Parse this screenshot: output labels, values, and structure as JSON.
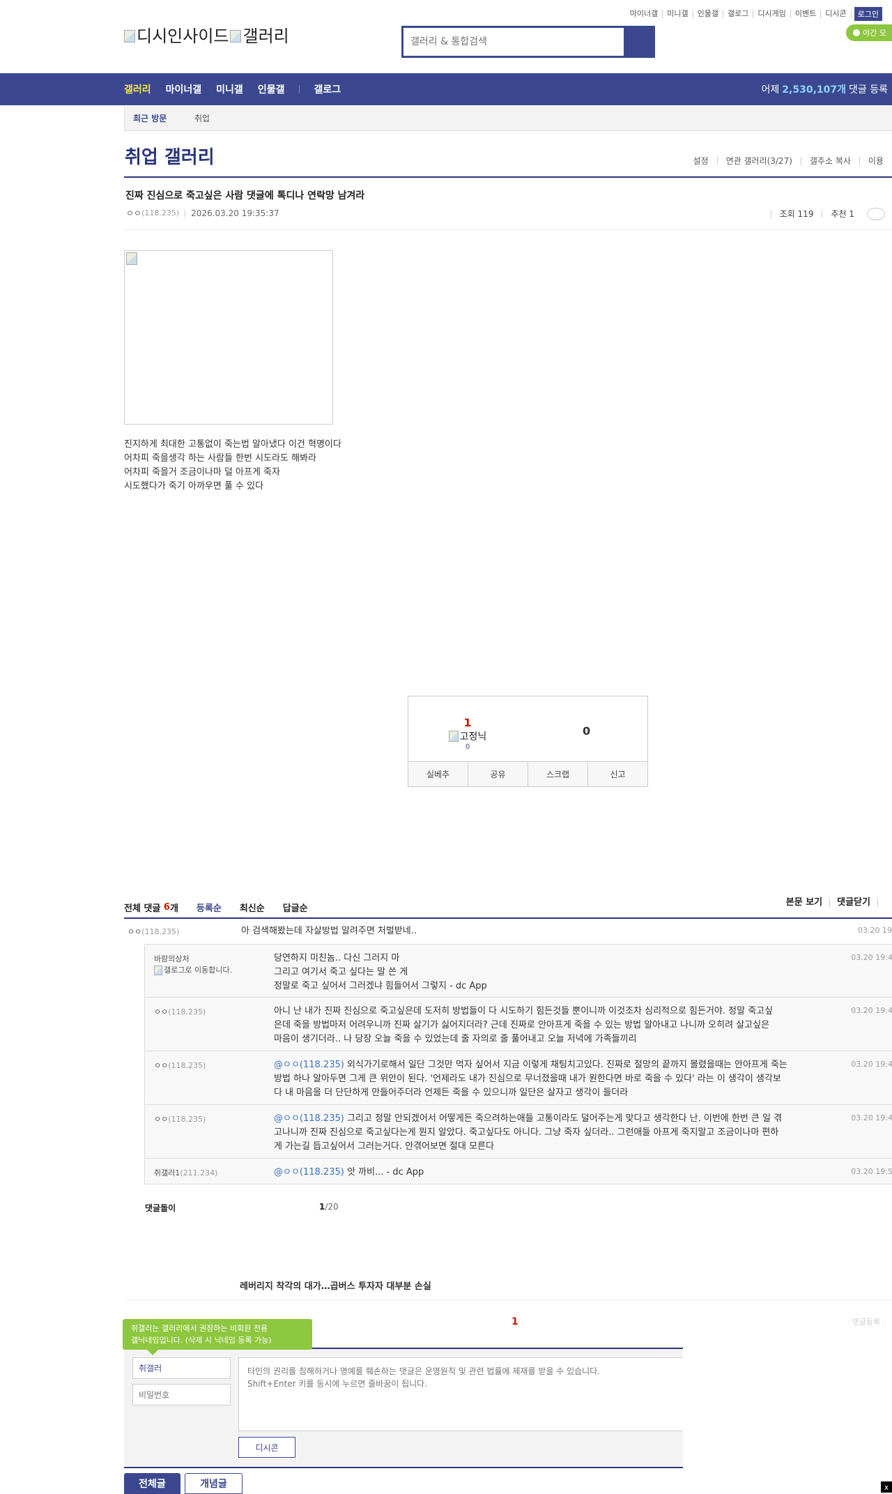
{
  "header": {
    "logo_alt": "디시인사이드",
    "logo_sub_alt": "갤러리",
    "search_placeholder": "갤러리 & 통합검색",
    "top_links": [
      "마이너갤",
      "미니갤",
      "인물갤",
      "갤로그",
      "디시게임",
      "이벤트",
      "디시콘"
    ],
    "login_label": "로그인",
    "night_label": "야간 모"
  },
  "nav": {
    "items": [
      "갤러리",
      "마이너갤",
      "미니갤",
      "인물갤"
    ],
    "gallog": "갤로그",
    "yesterday_prefix": "어제",
    "yesterday_count": "2,530,107개",
    "yesterday_suffix": "댓글 등록"
  },
  "recent": {
    "label": "최근 방문",
    "item": "취업"
  },
  "gallery": {
    "title": "취업 갤러리",
    "links": [
      "설정",
      "연관 갤러리(3/27)",
      "갤주소 복사",
      "이용"
    ]
  },
  "post": {
    "title": "진짜 진심으로 죽고싶은 사람 댓글에 톡디나 연락망 남겨라",
    "author": "ㅇㅇ",
    "ip": "(118.235)",
    "datetime": "2026.03.20 19:35:37",
    "views": "조회 119",
    "recommend": "추천 1",
    "content_lines": [
      "진지하게 최대한 고통없이 죽는법 알아냈다 이건 혁명이다",
      "어차피 죽을생각 하는 사람들 한번 시도라도 해봐라",
      "어차피 죽을거 조금이나마 덜 아프게 죽자",
      "시도했다가 죽기 아까우면 풀 수 있다"
    ]
  },
  "recommend_box": {
    "up_count": "1",
    "fixed_nick_alt": "고정닉",
    "fixed_count": "0",
    "down_count": "0",
    "buttons": [
      "실베추",
      "공유",
      "스크랩",
      "신고"
    ]
  },
  "comments": {
    "label": "전체 댓글",
    "count": "6",
    "unit": "개",
    "tabs": [
      "등록순",
      "최신순",
      "답글순"
    ],
    "right_links": [
      "본문 보기",
      "댓글닫기"
    ],
    "main": {
      "nick": "ㅇㅇ",
      "ip": "(118.235)",
      "text": "아 검색해봤는데 자살방법 알려주면 처벌받네..",
      "date": "03.20 19"
    },
    "replies": [
      {
        "nick": "바람의상처",
        "ip": "",
        "gallog": "갤로그로 이동합니다.",
        "at": "",
        "lines": [
          "당연하지 미친놈.. 다신 그러지 마",
          "그리고 여기서 죽고 싶다는 말 쓴 게",
          "정말로 죽고 싶어서 그러겠냐 힘들어서 그렇지 - dc App"
        ],
        "date": "03.20 19:4"
      },
      {
        "nick": "ㅇㅇ",
        "ip": "(118.235)",
        "gallog": "",
        "at": "",
        "lines": [
          "아니 난 내가 진짜 진심으로 죽고싶은데 도저히 방법들이 다 시도하기 힘든것들 뿐이니까 이것조차 심리적으로 힘든거야. 정말 죽고싶",
          "은데 죽을 방법마저 어려우니까 진짜 살기가 싫어지더라? 근데 진짜로 안아프게 죽을 수 있는 방법 알아내고 나니까 오히려 살고싶은",
          "마음이 생기더라.. 나 당장 오늘 죽을 수 있었는데 줄 자의로 줄 풀어내고 오늘 저녁에 가족들끼리"
        ],
        "date": "03.20 19:4"
      },
      {
        "nick": "ㅇㅇ",
        "ip": "(118.235)",
        "gallog": "",
        "at": "@ㅇㅇ(118.235)",
        "lines": [
          " 외식가기로해서 일단 그것만 먹자 싶어서 지금 이렇게 채팅치고있다. 진짜로 절망의 끝까지 몰렸을때는 안아프게 죽는",
          "방법 하나 알아두면 그게 큰 위안이 된다. '언제라도 내가 진심으로 무너졌을때 내가 원한다면 바로 죽을 수 있다' 라는 이 생각이 생각보",
          "다 내 마음을 더 단단하게 만들어주더라 언제든 죽을 수 있으니까 일단은 살자고 생각이 들더라"
        ],
        "date": "03.20 19:4"
      },
      {
        "nick": "ㅇㅇ",
        "ip": "(118.235)",
        "gallog": "",
        "at": "@ㅇㅇ(118.235)",
        "lines": [
          " 그리고 정말 안되겠어서 어떻게든 죽으려하는애들 고통이라도 덜어주는게 맞다고 생각한다 난. 이번에 한번 큰 일 겪",
          "고나니까 진짜 진심으로 죽고싶다는게 뭔지 알았다. 죽고싶다도 아니다. 그냥 죽자 싶더라.. 그런애들 아프게 죽지말고 조금이나마 편하",
          "게 가는길 듭고싶어서 그러는거다. 안겪어보면 절대 모른다"
        ],
        "date": "03.20 19:4"
      },
      {
        "nick": "취갤러1",
        "ip": "(211.234)",
        "gallog": "",
        "at": "@ㅇㅇ(118.235)",
        "lines": [
          " 앗 까비... - dc App"
        ],
        "date": "03.20 19:5"
      }
    ],
    "footer_label": "댓글돌이",
    "page_current": "1",
    "page_total": "/20"
  },
  "next_post": {
    "title": "레버리지 착각의 대가…곱버스 투자자 대부분 손실",
    "red_num": "1",
    "faint": "· 댓글등록 ·"
  },
  "write": {
    "tooltip_line1": "취갤러는 갤러리에서 권장하는 비회원 전용",
    "tooltip_line2": "갤닉네임입니다. (삭제 시 닉네임 등록 가능)",
    "nick_value": "취갤러",
    "pw_placeholder": "비밀번호",
    "textarea_placeholder": "타인의 권리를 침해하거나 명예를 훼손하는 댓글은 운영원칙 및 관련 법률에 제재를 받을 수 있습니다.\nShift+Enter 키를 동시에 누르면 줄바꿈이 됩니다.",
    "dccon_label": "디시콘",
    "tab_all": "전체글",
    "tab_concept": "개념글"
  }
}
